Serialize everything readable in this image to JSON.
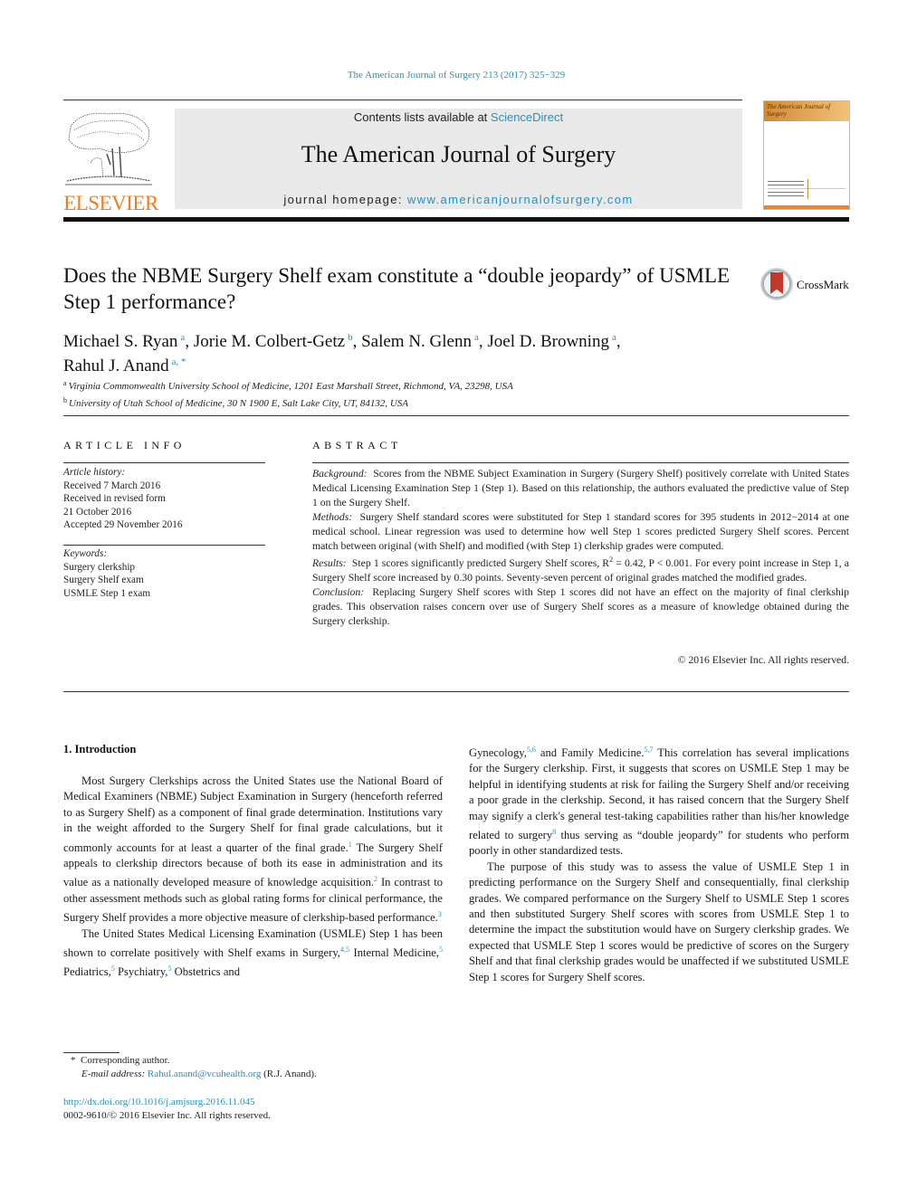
{
  "header": {
    "journal_reference": "The American Journal of Surgery 213 (2017) 325−329",
    "publisher_wordmark": "ELSEVIER",
    "contents_prefix": "Contents lists available at ",
    "contents_link": "ScienceDirect",
    "journal_name": "The American Journal of Surgery",
    "homepage_prefix": "journal homepage: ",
    "homepage_link": "www.americanjournalofsurgery.com",
    "cover_title": "The American Journal of Surgery",
    "crossmark_label": "CrossMark"
  },
  "article": {
    "title": "Does the NBME Surgery Shelf exam constitute a “double jeopardy” of USMLE Step 1 performance?",
    "authors": [
      {
        "name": "Michael S. Ryan",
        "aff": "a",
        "sep": ", "
      },
      {
        "name": "Jorie M. Colbert-Getz",
        "aff": "b",
        "sep": ", "
      },
      {
        "name": "Salem N. Glenn",
        "aff": "a",
        "sep": ", "
      },
      {
        "name": "Joel D. Browning",
        "aff": "a",
        "sep": ","
      },
      {
        "name": "Rahul J. Anand",
        "aff": "a, *",
        "sep": ""
      }
    ],
    "affiliations": [
      {
        "key": "a",
        "text": "Virginia Commonwealth University School of Medicine, 1201 East Marshall Street, Richmond, VA, 23298, USA"
      },
      {
        "key": "b",
        "text": "University of Utah School of Medicine, 30 N 1900 E, Salt Lake City, UT, 84132, USA"
      }
    ]
  },
  "article_info": {
    "heading": "ARTICLE INFO",
    "history_label": "Article history:",
    "history": [
      "Received 7 March 2016",
      "Received in revised form",
      "21 October 2016",
      "Accepted 29 November 2016"
    ],
    "keywords_label": "Keywords:",
    "keywords": [
      "Surgery clerkship",
      "Surgery Shelf exam",
      "USMLE Step 1 exam"
    ]
  },
  "abstract": {
    "heading": "ABSTRACT",
    "sections": [
      {
        "label": "Background:",
        "text": "Scores from the NBME Subject Examination in Surgery (Surgery Shelf) positively correlate with United States Medical Licensing Examination Step 1 (Step 1). Based on this relationship, the authors evaluated the predictive value of Step 1 on the Surgery Shelf."
      },
      {
        "label": "Methods:",
        "text": "Surgery Shelf standard scores were substituted for Step 1 standard scores for 395 students in 2012−2014 at one medical school. Linear regression was used to determine how well Step 1 scores predicted Surgery Shelf scores. Percent match between original (with Shelf) and modified (with Step 1) clerkship grades were computed."
      },
      {
        "label": "Results:",
        "text_before": "Step 1 scores significantly predicted Surgery Shelf scores, R",
        "sup": "2",
        "text": " = 0.42, P < 0.001. For every point increase in Step 1, a Surgery Shelf score increased by 0.30 points. Seventy-seven percent of original grades matched the modified grades."
      },
      {
        "label": "Conclusion:",
        "text": "Replacing Surgery Shelf scores with Step 1 scores did not have an effect on the majority of final clerkship grades. This observation raises concern over use of Surgery Shelf scores as a measure of knowledge obtained during the Surgery clerkship."
      }
    ],
    "copyright": "© 2016 Elsevier Inc. All rights reserved."
  },
  "body": {
    "section_heading": "1.  Introduction",
    "left_paragraphs": [
      [
        {
          "t": "Most Surgery Clerkships across the United States use the National Board of Medical Examiners (NBME) Subject Examination in Surgery (henceforth referred to as Surgery Shelf) as a component of final grade determination. Institutions vary in the weight afforded to the Surgery Shelf for final grade calculations, but it commonly accounts for at least a quarter of the final grade."
        },
        {
          "ref": "1"
        },
        {
          "t": " The Surgery Shelf appeals to clerkship directors because of both its ease in administration and its value as a nationally developed measure of knowledge acquisition."
        },
        {
          "ref": "2"
        },
        {
          "t": " In contrast to other assessment methods such as global rating forms for clinical performance, the Surgery Shelf provides a more objective measure of clerkship-based performance."
        },
        {
          "ref": "3"
        }
      ],
      [
        {
          "t": "The United States Medical Licensing Examination (USMLE) Step 1 has been shown to correlate positively with Shelf exams in Surgery,"
        },
        {
          "ref": "4,5"
        },
        {
          "t": " Internal Medicine,"
        },
        {
          "ref": "5"
        },
        {
          "t": " Pediatrics,"
        },
        {
          "ref": "5"
        },
        {
          "t": " Psychiatry,"
        },
        {
          "ref": "5"
        },
        {
          "t": " Obstetrics and"
        }
      ]
    ],
    "right_paragraphs": [
      [
        {
          "t": "Gynecology,"
        },
        {
          "ref": "5,6"
        },
        {
          "t": " and Family Medicine."
        },
        {
          "ref": "5,7"
        },
        {
          "t": " This correlation has several implications for the Surgery clerkship. First, it suggests that scores on USMLE Step 1 may be helpful in identifying students at risk for failing the Surgery Shelf and/or receiving a poor grade in the clerkship. Second, it has raised concern that the Surgery Shelf may signify a clerk's general test-taking capabilities rather than his/her knowledge related to surgery"
        },
        {
          "ref": "8"
        },
        {
          "t": " thus serving as “double jeopardy” for students who perform poorly in other standardized tests."
        }
      ],
      [
        {
          "t": "The purpose of this study was to assess the value of USMLE Step 1 in predicting performance on the Surgery Shelf and consequentially, final clerkship grades. We compared performance on the Surgery Shelf to USMLE Step 1 scores and then substituted Surgery Shelf scores with scores from USMLE Step 1 to determine the impact the substitution would have on Surgery clerkship grades. We expected that USMLE Step 1 scores would be predictive of scores on the Surgery Shelf and that final clerkship grades would be unaffected if we substituted USMLE Step 1 scores for Surgery Shelf scores."
        }
      ]
    ]
  },
  "footer": {
    "corresponding_mark": "*",
    "corresponding_label": "Corresponding author.",
    "email_label": "E-mail address:",
    "email": "Rahul.anand@vcuhealth.org",
    "email_suffix": " (R.J. Anand).",
    "doi": "http://dx.doi.org/10.1016/j.amjsurg.2016.11.045",
    "issn_copyright": "0002-9610/© 2016 Elsevier Inc. All rights reserved."
  },
  "colors": {
    "link": "#2a8fbd",
    "elsevier_orange": "#f07c1e",
    "masthead_bg": "#e9e9e9"
  }
}
